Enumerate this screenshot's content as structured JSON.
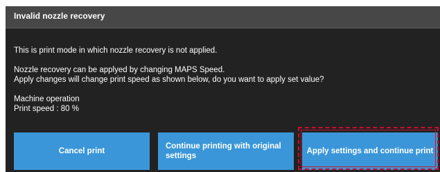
{
  "dialog": {
    "title": "Invalid nozzle recovery",
    "messages": [
      "This is print mode in which nozzle recovery is not applied.",
      "Nozzle recovery can be applyed by changing MAPS Speed.",
      "Apply changes will change print speed as shown below, do you want to apply set value?",
      "Machine operation",
      "Print speed : 80 %"
    ]
  },
  "buttons": {
    "cancel_label": "Cancel print",
    "continue_label": "Continue printing with original settings",
    "apply_label": "Apply settings and continue print"
  },
  "colors": {
    "header_bg": "#474747",
    "body_bg": "#222222",
    "button_bg": "#3a96d8",
    "highlight": "#c8102e"
  }
}
